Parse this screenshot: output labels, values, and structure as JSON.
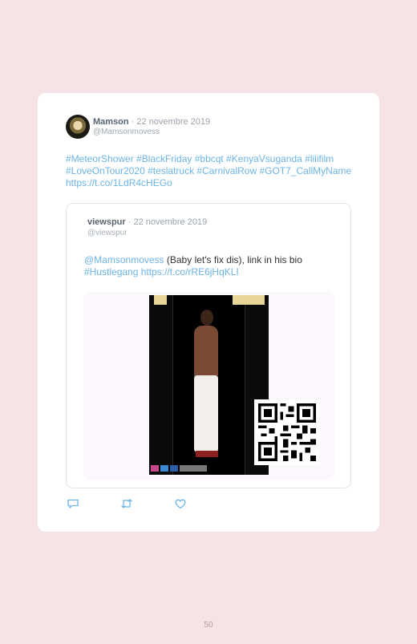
{
  "tweet": {
    "author_name": "Mamson",
    "date": " · 22 novembre 2019",
    "handle": "@Mamsonmovess",
    "text": "#MeteorShower #BlackFriday #bbcqt #KenyaVsuganda #lilifilm #LoveOnTour2020 #teslatruck #CarnivalRow #GOT7_CallMyName https://t.co/1LdR4cHEGo"
  },
  "quoted": {
    "author_name": "viewspur",
    "date": " · 22 novembre 2019",
    "handle": "@viewspur",
    "mention": "@Mamsonmovess",
    "text_middle": " (Baby let's fix dis), link in his bio ",
    "hashtag_link": "#Hustlegang https://t.co/rRE6jHqKLI"
  },
  "actions": {
    "reply_icon": "reply-icon",
    "retweet_icon": "retweet-icon",
    "like_icon": "heart-icon"
  },
  "page_number": "50"
}
